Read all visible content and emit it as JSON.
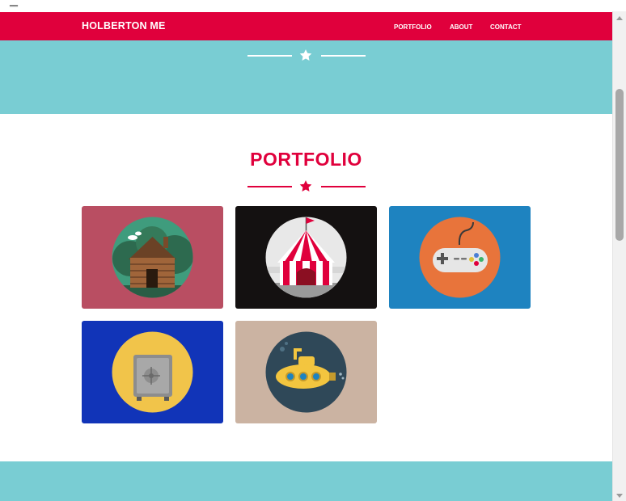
{
  "navbar": {
    "brand": "HOLBERTON ME",
    "links": [
      "PORTFOLIO",
      "ABOUT",
      "CONTACT"
    ]
  },
  "portfolio": {
    "title": "PORTFOLIO",
    "items": [
      {
        "icon": "log-cabin-icon",
        "bg": "#b94e62"
      },
      {
        "icon": "circus-tent-icon",
        "bg": "#141111"
      },
      {
        "icon": "game-controller-icon",
        "bg": "#1e83c0"
      },
      {
        "icon": "safe-icon",
        "bg": "#1134b8"
      },
      {
        "icon": "submarine-icon",
        "bg": "#cbb3a2"
      }
    ]
  },
  "colors": {
    "brand_red": "#e0003c",
    "teal": "#79cdd3"
  }
}
